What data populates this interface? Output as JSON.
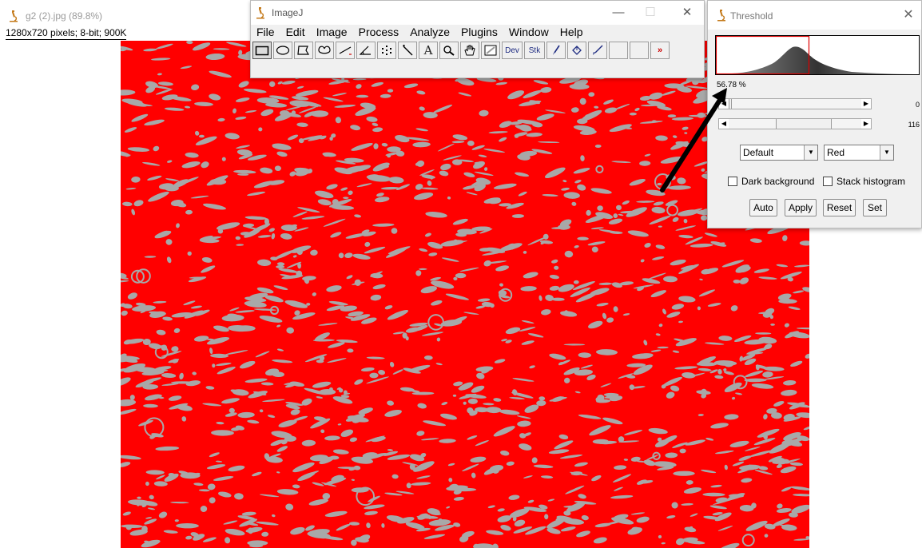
{
  "image_window": {
    "title": "g2 (2).jpg (89.8%)",
    "info": "1280x720 pixels; 8-bit; 900K"
  },
  "imagej": {
    "title": "ImageJ",
    "controls": {
      "minimize": "—",
      "maximize": "☐",
      "close": "✕"
    },
    "menu": [
      "File",
      "Edit",
      "Image",
      "Process",
      "Analyze",
      "Plugins",
      "Window",
      "Help"
    ],
    "tools": [
      {
        "name": "rectangle-tool-icon",
        "label": ""
      },
      {
        "name": "oval-tool-icon",
        "label": ""
      },
      {
        "name": "polygon-tool-icon",
        "label": ""
      },
      {
        "name": "freehand-tool-icon",
        "label": ""
      },
      {
        "name": "line-tool-icon",
        "label": ""
      },
      {
        "name": "angle-tool-icon",
        "label": ""
      },
      {
        "name": "point-tool-icon",
        "label": ""
      },
      {
        "name": "wand-tool-icon",
        "label": ""
      },
      {
        "name": "text-tool-icon",
        "label": "A"
      },
      {
        "name": "magnifier-tool-icon",
        "label": ""
      },
      {
        "name": "hand-tool-icon",
        "label": ""
      },
      {
        "name": "color-picker-tool-icon",
        "label": ""
      },
      {
        "name": "dev-menu-tool",
        "label": "Dev"
      },
      {
        "name": "stk-menu-tool",
        "label": "Stk"
      },
      {
        "name": "brush-tool-icon",
        "label": ""
      },
      {
        "name": "flood-fill-tool-icon",
        "label": ""
      },
      {
        "name": "pencil-tool-icon",
        "label": ""
      },
      {
        "name": "empty-slot-1",
        "label": ""
      },
      {
        "name": "empty-slot-2",
        "label": ""
      },
      {
        "name": "more-tools-icon",
        "label": "»"
      }
    ]
  },
  "threshold": {
    "title": "Threshold",
    "close": "✕",
    "percent": "56.78 %",
    "slider_min": {
      "value": "0",
      "fraction": 0.0
    },
    "slider_max": {
      "value": "116",
      "fraction": 0.455
    },
    "method": "Default",
    "display": "Red",
    "dark_background": {
      "label": "Dark background",
      "checked": false
    },
    "stack_histogram": {
      "label": "Stack histogram",
      "checked": false
    },
    "buttons": {
      "auto": "Auto",
      "apply": "Apply",
      "reset": "Reset",
      "set": "Set"
    }
  },
  "colors": {
    "overlay_red": "#ff0000",
    "tissue_gray": "#a8a8a8",
    "threshold_box": "#e00000",
    "menu_text": "#000000"
  }
}
